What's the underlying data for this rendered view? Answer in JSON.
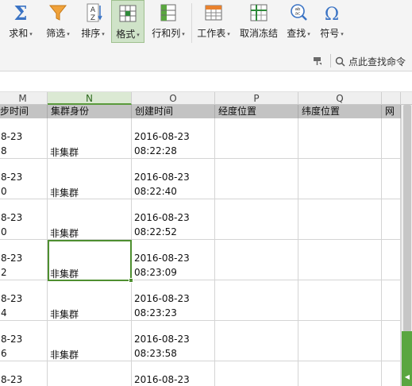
{
  "ribbon": {
    "buttons": [
      {
        "label": "求和",
        "icon": "sigma-icon"
      },
      {
        "label": "筛选",
        "icon": "funnel-icon"
      },
      {
        "label": "排序",
        "icon": "sort-az-icon"
      },
      {
        "label": "格式",
        "icon": "format-grid-icon"
      },
      {
        "label": "行和列",
        "icon": "rows-columns-icon"
      },
      {
        "label": "工作表",
        "icon": "worksheet-icon"
      },
      {
        "label": "取消冻结",
        "icon": "freeze-panes-icon"
      },
      {
        "label": "查找",
        "icon": "find-icon"
      },
      {
        "label": "符号",
        "icon": "omega-icon"
      }
    ],
    "dropdown_marker": "▾",
    "accent_color": "#4e8f30"
  },
  "command_search": {
    "label": "点此查找命令"
  },
  "sheet": {
    "column_letters": [
      "M",
      "N",
      "O",
      "P",
      "Q"
    ],
    "selected_column": "N",
    "header_row": [
      "步时间",
      "集群身份",
      "创建时间",
      "经度位置",
      "纬度位置",
      "网"
    ],
    "rows": [
      {
        "m1": "8-23",
        "m2": "8",
        "n": "非集群",
        "o1": "2016-08-23",
        "o2": "08:22:28"
      },
      {
        "m1": "8-23",
        "m2": "0",
        "n": "非集群",
        "o1": "2016-08-23",
        "o2": "08:22:40"
      },
      {
        "m1": "8-23",
        "m2": "0",
        "n": "非集群",
        "o1": "2016-08-23",
        "o2": "08:22:52"
      },
      {
        "m1": "8-23",
        "m2": "2",
        "n": "非集群",
        "o1": "2016-08-23",
        "o2": "08:23:09"
      },
      {
        "m1": "8-23",
        "m2": "4",
        "n": "非集群",
        "o1": "2016-08-23",
        "o2": "08:23:23"
      },
      {
        "m1": "8-23",
        "m2": "6",
        "n": "非集群",
        "o1": "2016-08-23",
        "o2": "08:23:58"
      },
      {
        "m1": "8-23",
        "m2": "",
        "n": "",
        "o1": "2016-08-23",
        "o2": ""
      }
    ]
  }
}
